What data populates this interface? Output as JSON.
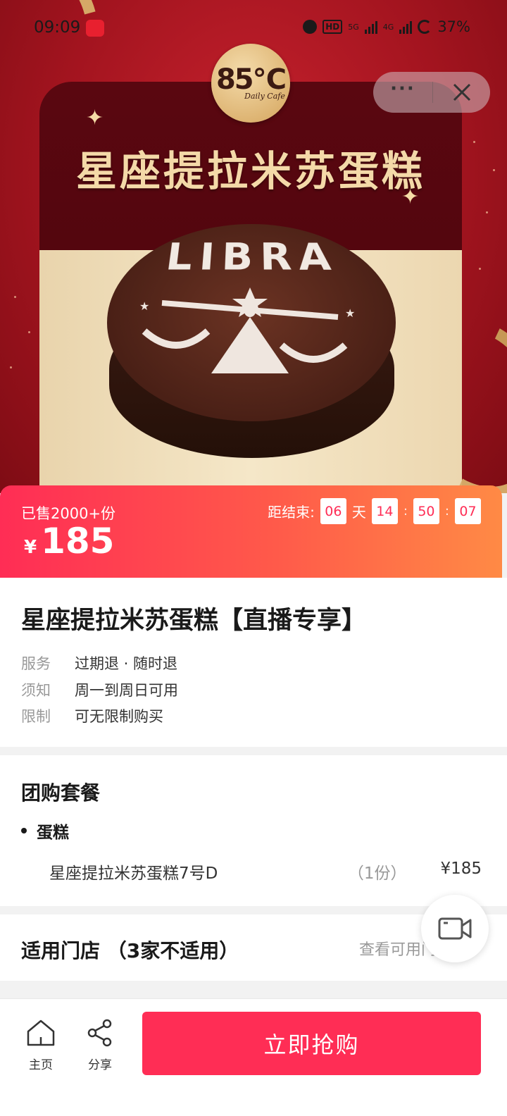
{
  "status_bar": {
    "time": "09:09",
    "network_1": "5G",
    "network_2": "4G",
    "hd": "HD",
    "battery": "37%"
  },
  "hero": {
    "brand_logo": "85℃",
    "brand_logo_sub": "Daily Cafe",
    "title": "星座提拉米苏蛋糕",
    "cake_text": "LIBRA"
  },
  "capsule": {
    "more_label": "···"
  },
  "deal": {
    "sold": "已售2000+份",
    "currency": "¥",
    "price": "185",
    "countdown_label": "距结束:",
    "days": "06",
    "day_unit": "天",
    "hours": "14",
    "minutes": "50",
    "seconds": "07",
    "sep": ":"
  },
  "product": {
    "title": "星座提拉米苏蛋糕【直播专享】",
    "rows": [
      {
        "key": "服务",
        "value": "过期退 · 随时退"
      },
      {
        "key": "须知",
        "value": "周一到周日可用"
      },
      {
        "key": "限制",
        "value": "可无限制购买"
      }
    ]
  },
  "package": {
    "title": "团购套餐",
    "category": "蛋糕",
    "item_name": "星座提拉米苏蛋糕7号D",
    "item_qty": "（1份）",
    "item_price": "¥185"
  },
  "stores": {
    "title": "适用门店 （3家不适用）",
    "link": "查看可用门"
  },
  "bottom": {
    "home_label": "主页",
    "share_label": "分享",
    "buy_label": "立即抢购"
  },
  "colors": {
    "accent": "#ff2d55",
    "gold": "#f4d9a8",
    "hero_red": "#a3141f"
  }
}
